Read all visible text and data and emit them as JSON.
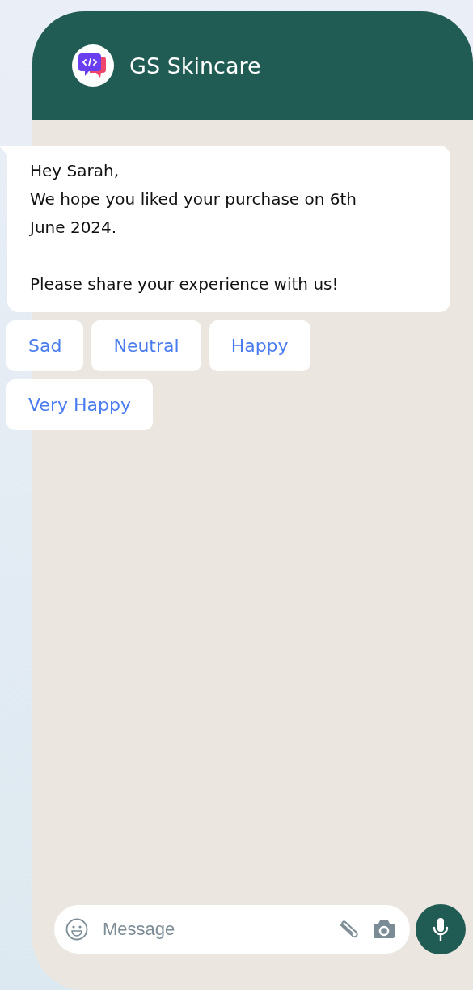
{
  "header": {
    "title": "GS Skincare"
  },
  "message": {
    "paragraphs": [
      "Hey Sarah,\nWe hope you liked your purchase on 6th June 2024.",
      "Please share your experience with us!"
    ]
  },
  "quick_replies": [
    "Sad",
    "Neutral",
    "Happy",
    "Very Happy"
  ],
  "composer": {
    "placeholder": "Message"
  }
}
